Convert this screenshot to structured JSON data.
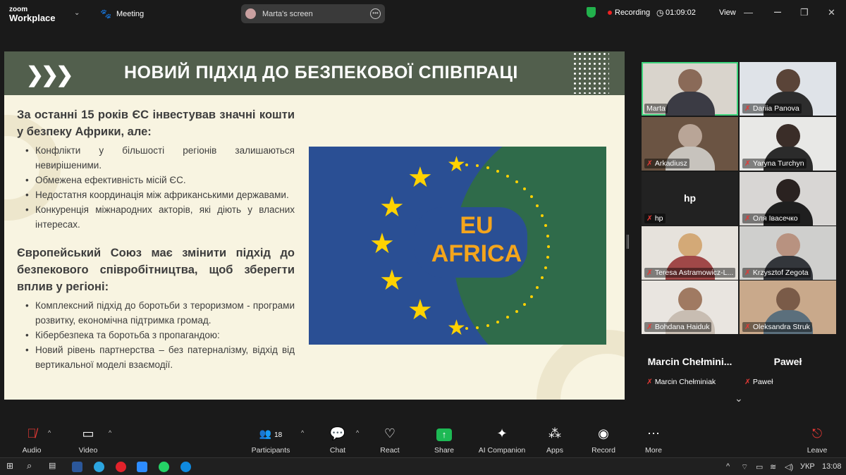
{
  "app": {
    "logo_top": "zoom",
    "logo_bottom": "Workplace",
    "meeting_label": "Meeting",
    "screen_share_label": "Marta's screen",
    "recording_label": "Recording",
    "timer": "01:09:02",
    "view_label": "View"
  },
  "slide": {
    "title": "НОВИЙ ПІДХІД ДО БЕЗПЕКОВОЇ СПІВПРАЦІ",
    "heading1": "За останні 15 років ЄС інвестував значні кошти у безпеку Африки, але:",
    "bullets1": [
      "Конфлікти у більшості регіонів залишаються невирішеними.",
      "Обмежена ефективність місій ЄС.",
      "Недостатня координація між африканськими державами.",
      "Конкуренція міжнародних акторів, які діють у власних інтересах."
    ],
    "heading2": "Європейський Союз має змінити підхід до безпекового співробітництва, щоб зберегти вплив у регіоні:",
    "bullets2": [
      "Комплексний підхід до боротьби з тероризмом - програми розвитку, економічна підтримка громад.",
      "Кібербезпека та боротьба з пропагандою:",
      "Новий рівень партнерства – без патерналізму, відхід від вертикальної моделі взаємодії."
    ],
    "image_text_top": "EU",
    "image_text_bottom": "AFRICA"
  },
  "participants": [
    {
      "name": "Marta",
      "muted": false
    },
    {
      "name": "Dariia Panova",
      "muted": true
    },
    {
      "name": "Arkadiusz",
      "muted": true
    },
    {
      "name": "Yaryna Turchyn",
      "muted": true
    },
    {
      "name": "hp",
      "muted": true,
      "big": "hp"
    },
    {
      "name": "Оля Івасечко",
      "muted": true
    },
    {
      "name": "Teresa Astramowicz-L...",
      "muted": true
    },
    {
      "name": "Krzysztof Zegota",
      "muted": true
    },
    {
      "name": "Bohdana Haiduk",
      "muted": true
    },
    {
      "name": "Oleksandra Struk",
      "muted": true
    },
    {
      "name": "Marcin Chełminiak",
      "muted": true,
      "big": "Marcin Chełmini..."
    },
    {
      "name": "Paweł",
      "muted": true,
      "big": "Paweł"
    }
  ],
  "toolbar": {
    "audio": "Audio",
    "video": "Video",
    "participants": "Participants",
    "participants_count": "18",
    "chat": "Chat",
    "react": "React",
    "share": "Share",
    "ai": "AI Companion",
    "apps": "Apps",
    "record": "Record",
    "more": "More",
    "leave": "Leave"
  },
  "taskbar": {
    "lang": "УКР",
    "time": "13:08"
  },
  "colors": {
    "slide_header": "#525f4d",
    "slide_bg": "#f8f4e1",
    "eu_blue": "#2a4f94",
    "africa_green": "#2f6b4a",
    "star_yellow": "#ffd200",
    "active_speaker": "#3ed47c",
    "recording_red": "#e22222"
  }
}
